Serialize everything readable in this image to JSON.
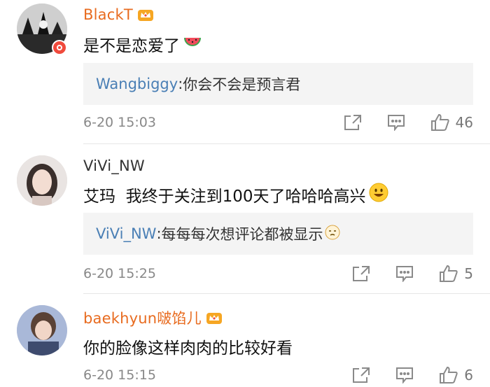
{
  "comments": [
    {
      "username": "BlackT",
      "vip": true,
      "verified": true,
      "text": "是不是恋爱了",
      "emoji": "watermelon-emoji",
      "reply": {
        "name": "Wangbiggy",
        "separator": ": ",
        "text": "你会不会是预言君"
      },
      "time": "6-20 15:03",
      "likes": "46"
    },
    {
      "username": "ViVi_NW",
      "vip": false,
      "verified": false,
      "text": "艾玛  我终于关注到100天了哈哈哈高兴",
      "emoji": "grinning-emoji",
      "reply": {
        "name": "ViVi_NW",
        "separator": ": ",
        "text": "每每每次想评论都被显示"
      },
      "time": "6-20 15:25",
      "likes": "5"
    },
    {
      "username": "baekhyun啵馅儿",
      "vip": true,
      "verified": false,
      "text": "你的脸像这样肉肉的比较好看",
      "time": "6-20 15:15",
      "likes": "6"
    }
  ],
  "colors": {
    "vip_name": "#e86b1f",
    "reply_name": "#4a7fb5",
    "meta_gray": "#888888",
    "reply_bg": "#f4f4f4"
  }
}
